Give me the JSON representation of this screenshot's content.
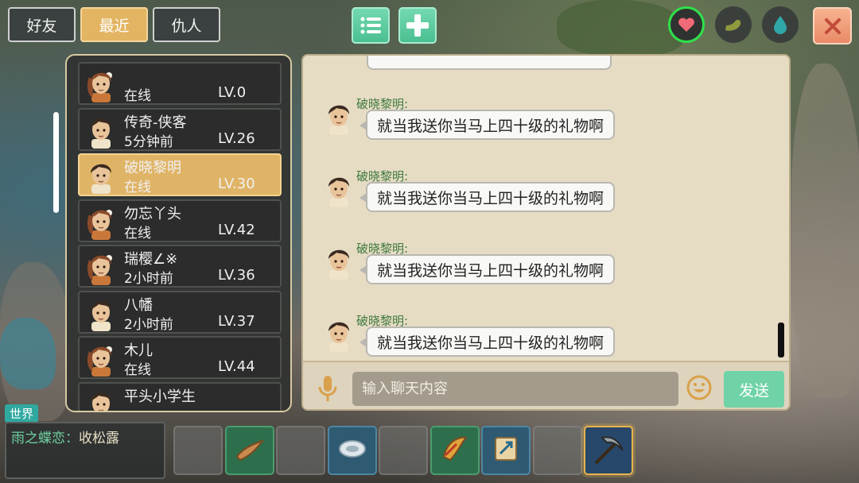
{
  "tabs": [
    {
      "label": "好友",
      "active": false
    },
    {
      "label": "最近",
      "active": true
    },
    {
      "label": "仇人",
      "active": false
    }
  ],
  "toolbar": {
    "list_icon": "list-icon",
    "add_icon": "plus-icon"
  },
  "status_icons": [
    "heart-icon",
    "stomach-icon",
    "water-drop-icon"
  ],
  "friends": [
    {
      "name": "",
      "status": "在线",
      "level": "LV.0",
      "gender": "female",
      "active": false
    },
    {
      "name": "传奇-侠客",
      "status": "5分钟前",
      "level": "LV.26",
      "gender": "male",
      "active": false
    },
    {
      "name": "破晓黎明",
      "status": "在线",
      "level": "LV.30",
      "gender": "male",
      "active": true
    },
    {
      "name": "勿忘丫头",
      "status": "在线",
      "level": "LV.42",
      "gender": "female",
      "active": false
    },
    {
      "name": "瑞樱∠※",
      "status": "2小时前",
      "level": "LV.36",
      "gender": "female",
      "active": false
    },
    {
      "name": "八幡",
      "status": "2小时前",
      "level": "LV.37",
      "gender": "male",
      "active": false
    },
    {
      "name": "木儿",
      "status": "在线",
      "level": "LV.44",
      "gender": "female",
      "active": false
    },
    {
      "name": "平头小学生",
      "status": "",
      "level": "",
      "gender": "male",
      "active": false
    }
  ],
  "messages": [
    {
      "sender": "破晓黎明:",
      "text": "就当我送你当马上四十级的礼物啊"
    },
    {
      "sender": "破晓黎明:",
      "text": "就当我送你当马上四十级的礼物啊"
    },
    {
      "sender": "破晓黎明:",
      "text": "就当我送你当马上四十级的礼物啊"
    },
    {
      "sender": "破晓黎明:",
      "text": "就当我送你当马上四十级的礼物啊"
    }
  ],
  "chat_input": {
    "placeholder": "输入聊天内容",
    "value": ""
  },
  "send_label": "发送",
  "world": {
    "tag": "世界",
    "sender": "雨之蝶恋：",
    "text": "收松露"
  },
  "hotbar": [
    {
      "item": "",
      "style": "empty"
    },
    {
      "item": "wooden-boomerang-icon",
      "style": "filled"
    },
    {
      "item": "",
      "style": "empty"
    },
    {
      "item": "fish-disc-icon",
      "style": "blue"
    },
    {
      "item": "",
      "style": "empty"
    },
    {
      "item": "horn-icon",
      "style": "filled"
    },
    {
      "item": "map-scroll-icon",
      "style": "blue"
    },
    {
      "item": "",
      "style": "empty"
    },
    {
      "item": "pickaxe-icon",
      "style": "sel"
    }
  ]
}
